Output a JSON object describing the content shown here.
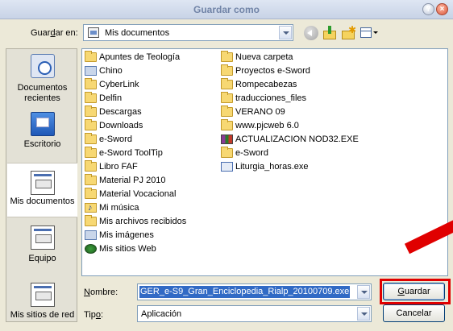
{
  "window": {
    "title": "Guardar como"
  },
  "toolbar": {
    "save_in_label_pre": "Guar",
    "save_in_label_u": "d",
    "save_in_label_post": "ar en:",
    "save_in_value": "Mis documentos"
  },
  "places": [
    {
      "label": "Documentos recientes",
      "icon": "recent-documents-icon"
    },
    {
      "label": "Escritorio",
      "icon": "desktop-icon"
    },
    {
      "label": "Mis documentos",
      "icon": "my-documents-icon"
    },
    {
      "label": "Equipo",
      "icon": "computer-icon"
    },
    {
      "label": "Mis sitios de red",
      "icon": "network-places-icon"
    }
  ],
  "files_col1": [
    "Apuntes de Teología",
    "Chino",
    "CyberLink",
    "Delfin",
    "Descargas",
    "Downloads",
    "e-Sword",
    "e-Sword ToolTip",
    "Libro FAF",
    "Material PJ 2010",
    "Material Vocacional",
    "Mi música",
    "Mis archivos recibidos",
    "Mis imágenes",
    "Mis sitios Web"
  ],
  "files_col2": [
    "Nueva carpeta",
    "Proyectos e-Sword",
    "Rompecabezas",
    "traducciones_files",
    "VERANO 09",
    "www.pjcweb 6.0",
    "ACTUALIZACION NOD32.EXE",
    "e-Sword",
    "Liturgia_horas.exe"
  ],
  "form": {
    "filename_label_u": "N",
    "filename_label_rest": "ombre:",
    "filename_value": "GER_e-S9_Gran_Enciclopedia_Rialp_20100709.exe",
    "type_label_pre": "Tip",
    "type_label_u": "o",
    "type_label_post": ":",
    "type_value": "Aplicación"
  },
  "buttons": {
    "save_u": "G",
    "save_rest": "uardar",
    "cancel": "Cancelar"
  },
  "colors": {
    "highlight": "#e00000",
    "selection": "#316ac5"
  }
}
